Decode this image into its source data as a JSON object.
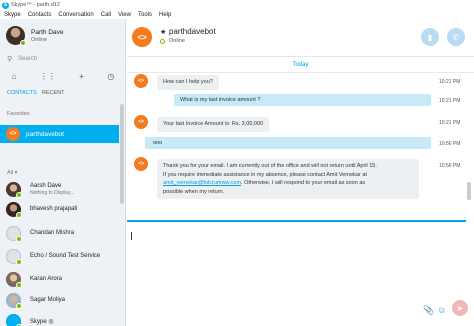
{
  "window": {
    "title": "Skype™ - parth.d12"
  },
  "menu": [
    "Skype",
    "Contacts",
    "Conversation",
    "Call",
    "View",
    "Tools",
    "Help"
  ],
  "profile": {
    "name": "Parth Dave",
    "status": "Online"
  },
  "search": {
    "placeholder": "Search"
  },
  "tabs": {
    "contacts": "CONTACTS",
    "recent": "RECENT"
  },
  "sections": {
    "favorites": "Favorites",
    "all": "All ▾"
  },
  "favorites": [
    {
      "name": "parthdavebot"
    }
  ],
  "contacts": [
    {
      "name": "Aarsh Dave",
      "sub": "Nothing to Display..."
    },
    {
      "name": "bhavesh prajapati",
      "sub": ""
    },
    {
      "name": "Chandan Mishra",
      "sub": ""
    },
    {
      "name": "Echo / Sound Test Service",
      "sub": ""
    },
    {
      "name": "Karan Arora",
      "sub": ""
    },
    {
      "name": "Sagar Moliya",
      "sub": ""
    },
    {
      "name": "Skype ◎",
      "sub": ""
    }
  ],
  "conversation": {
    "name": "parthdavebot",
    "status": "Online",
    "date_divider": "Today",
    "messages": [
      {
        "dir": "in",
        "text": "How can I help you?",
        "time": "10:21 PM"
      },
      {
        "dir": "out",
        "text": "What is my last invoice amount ?",
        "time": "10:21 PM"
      },
      {
        "dir": "in",
        "text": "Your last Invoice Amount is: Rs. 3,00,000",
        "time": "10:21 PM"
      },
      {
        "dir": "out",
        "text": "ooo",
        "time": "10:56 PM"
      },
      {
        "dir": "in",
        "line1": "Thank you for your email. I am currently out of the office and will not return until April 15.",
        "line2": "If you require immediate assistance in my absence, please contact Amit Vernekar at",
        "link": "amit_vernekar@fulcrumww.com",
        "line3_rest": ". Otherwise, I will respond to your email as soon as",
        "line4": "possible when my return.",
        "time": "10:56 PM"
      }
    ]
  },
  "icons": {
    "app": "skype-logo-icon",
    "search": "search-icon",
    "home": "home-icon",
    "dialpad": "dialpad-icon",
    "add": "add-icon",
    "history": "history-icon",
    "video": "video-call-icon",
    "call": "call-icon",
    "attach": "attach-icon",
    "emoji": "emoji-icon",
    "bot": "bot-avatar-icon"
  },
  "colors": {
    "accent": "#00aff0",
    "bot_orange": "#f47c20",
    "online_green": "#7fba00",
    "bubble_out": "#c7eaf9",
    "bubble_in": "#edf0f3"
  }
}
